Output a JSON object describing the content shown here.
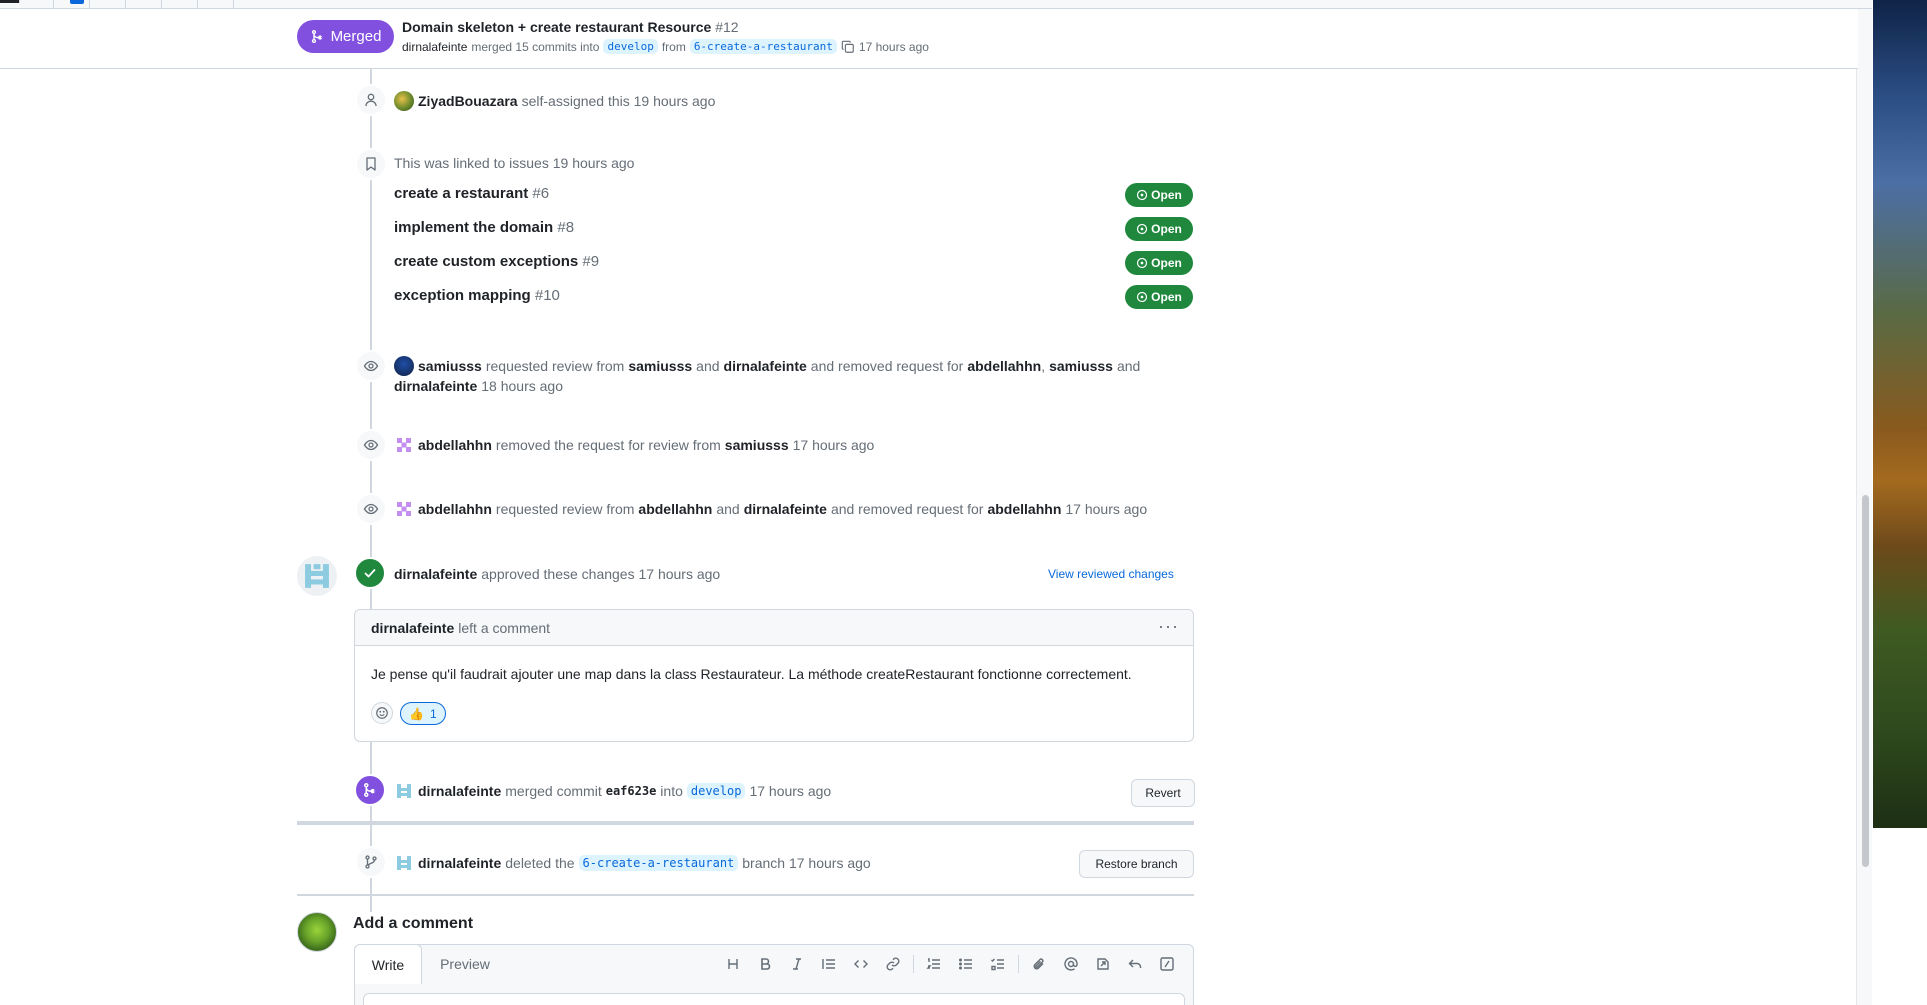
{
  "pr": {
    "status_label": "Merged",
    "title": "Domain skeleton + create restaurant Resource",
    "number": "#12",
    "author": "dirnalafeinte",
    "merged_text": "merged 15 commits into",
    "base_branch": "develop",
    "from_text": "from",
    "head_branch": "6-create-a-restaurant",
    "time": "17 hours ago"
  },
  "timeline": {
    "self_assign": {
      "actor": "ZiyadBouazara",
      "text": "self-assigned this 19 hours ago"
    },
    "linked": {
      "text": "This was linked to issues 19 hours ago",
      "issues": [
        {
          "title": "create a restaurant",
          "number": "#6",
          "status": "Open"
        },
        {
          "title": "implement the domain",
          "number": "#8",
          "status": "Open"
        },
        {
          "title": "create custom exceptions",
          "number": "#9",
          "status": "Open"
        },
        {
          "title": "exception mapping",
          "number": "#10",
          "status": "Open"
        }
      ]
    },
    "review1": {
      "actor": "samiusss",
      "t1": "requested review from",
      "u1": "samiusss",
      "t2": "and",
      "u2": "dirnalafeinte",
      "t3": "and removed request for",
      "u3": "abdellahhn",
      "t4": ",",
      "u4": "samiusss",
      "t5": "and",
      "u5": "dirnalafeinte",
      "time": "18 hours ago"
    },
    "review2": {
      "actor": "abdellahhn",
      "t1": "removed the request for review from",
      "u1": "samiusss",
      "time": "17 hours ago"
    },
    "review3": {
      "actor": "abdellahhn",
      "t1": "requested review from",
      "u1": "abdellahhn",
      "t2": "and",
      "u2": "dirnalafeinte",
      "t3": "and removed request for",
      "u3": "abdellahhn",
      "time": "17 hours ago"
    },
    "approval": {
      "actor": "dirnalafeinte",
      "text": "approved these changes 17 hours ago",
      "link": "View reviewed changes"
    },
    "comment": {
      "actor": "dirnalafeinte",
      "header_text": "left a comment",
      "body": "Je pense qu'il faudrait ajouter une map dans la class Restaurateur. La méthode createRestaurant fonctionne correctement.",
      "reaction_emoji": "👍",
      "reaction_count": "1"
    },
    "merge": {
      "actor": "dirnalafeinte",
      "t1": "merged commit",
      "commit": "eaf623e",
      "t2": "into",
      "branch": "develop",
      "time": "17 hours ago",
      "button": "Revert"
    },
    "delete": {
      "actor": "dirnalafeinte",
      "t1": "deleted the",
      "branch": "6-create-a-restaurant",
      "t2": "branch 17 hours ago",
      "button": "Restore branch"
    }
  },
  "add_comment": {
    "title": "Add a comment",
    "tab_write": "Write",
    "tab_preview": "Preview",
    "toolbar_icons": [
      "heading-icon",
      "bold-icon",
      "italic-icon",
      "quote-icon",
      "code-icon",
      "link-icon",
      "ordered-list-icon",
      "unordered-list-icon",
      "task-list-icon",
      "attach-icon",
      "mention-icon",
      "reference-icon",
      "reply-icon",
      "slash-command-icon"
    ]
  },
  "colors": {
    "merged": "#8250df",
    "open": "#1f883d",
    "link": "#0969da",
    "border": "#d0d7de"
  }
}
